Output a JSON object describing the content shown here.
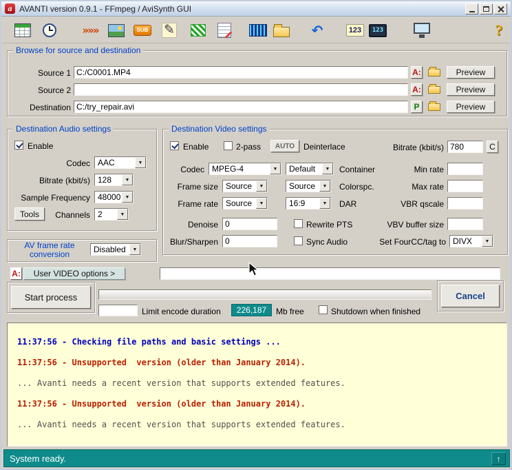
{
  "colors": {
    "group_title_blue": "#0040c8",
    "teal": "#0f8b8b",
    "log_bg": "#ffffd8",
    "log_blue": "#0000bb",
    "log_red": "#bb2000",
    "log_gray": "#505050",
    "badge_red": "#c11111",
    "badge_green": "#0a7a0a"
  },
  "ui": {
    "arrow": "▼"
  },
  "window": {
    "icon_letter": "a",
    "title": "AVANTI version 0.9.1 - FFmpeg / AviSynth GUI"
  },
  "toolbar": {
    "icons": [
      {
        "name": "job-control-icon",
        "glyph": ""
      },
      {
        "name": "timer-icon",
        "glyph": ""
      },
      {
        "name": "transitions-icon",
        "glyph": "»»»"
      },
      {
        "name": "image-editor-icon",
        "glyph": ""
      },
      {
        "name": "subtitles-icon",
        "glyph": "SUB"
      },
      {
        "name": "script-editor-icon",
        "glyph": "✎"
      },
      {
        "name": "priority-icon",
        "glyph": ""
      },
      {
        "name": "notes-icon",
        "glyph": ""
      },
      {
        "name": "waveform-icon",
        "glyph": ""
      },
      {
        "name": "folder-icon",
        "glyph": ""
      },
      {
        "name": "undo-icon",
        "glyph": "↶"
      },
      {
        "name": "numbers-icon",
        "glyph": "123"
      },
      {
        "name": "video-numbers-icon",
        "glyph": "123"
      },
      {
        "name": "monitor-icon",
        "glyph": ""
      },
      {
        "name": "help-icon",
        "glyph": "?"
      }
    ]
  },
  "browse": {
    "title": "Browse for source and destination",
    "preview_label": "Preview",
    "rows": [
      {
        "label": "Source 1",
        "value": "C:/C0001.MP4",
        "badge": "A:"
      },
      {
        "label": "Source 2",
        "value": "",
        "badge": "A:"
      },
      {
        "label": "Destination",
        "value": "C:/try_repair.avi",
        "badge": "P"
      }
    ]
  },
  "audio": {
    "title": "Destination Audio settings",
    "enable_label": "Enable",
    "codec_label": "Codec",
    "codec_value": "AAC",
    "bitrate_label": "Bitrate (kbit/s)",
    "bitrate_value": "128",
    "sample_label": "Sample Frequency",
    "sample_value": "48000",
    "tools_label": "Tools",
    "channels_label": "Channels",
    "channels_value": "2"
  },
  "video": {
    "title": "Destination Video settings",
    "enable_label": "Enable",
    "two_pass_label": "2-pass",
    "auto_label": "AUTO",
    "deinterlace_label": "Deinterlace",
    "bitrate_label": "Bitrate (kbit/s)",
    "bitrate_value": "780",
    "c_button_label": "C",
    "codec_label": "Codec",
    "codec_value": "MPEG-4",
    "profile_value": "Default",
    "container_label": "Container",
    "min_rate_label": "Min rate",
    "min_rate_value": "",
    "frame_size_label": "Frame size",
    "frame_size_value": "Source",
    "colorspace_value": "Source",
    "colorspace_label": "Colorspc.",
    "max_rate_label": "Max rate",
    "max_rate_value": "",
    "frame_rate_label": "Frame rate",
    "frame_rate_value": "Source",
    "dar_value": "16:9",
    "dar_label": "DAR",
    "vbr_qscale_label": "VBR qscale",
    "vbr_qscale_value": "",
    "denoise_label": "Denoise",
    "denoise_value": "0",
    "rewrite_pts_label": "Rewrite PTS",
    "vbv_label": "VBV buffer size",
    "vbv_value": "",
    "blur_label": "Blur/Sharpen",
    "blur_value": "0",
    "sync_audio_label": "Sync Audio",
    "fourcc_label": "Set FourCC/tag to",
    "fourcc_value": "DIVX"
  },
  "av_conversion": {
    "label_line1": "AV frame rate",
    "label_line2": "conversion",
    "value": "Disabled"
  },
  "user_options": {
    "badge": "A:",
    "button_label": "User VIDEO options >",
    "value": ""
  },
  "process": {
    "start_label": "Start process",
    "cancel_label": "Cancel",
    "limit_value": "",
    "limit_label": "Limit encode duration",
    "free_space_value": "226,187",
    "free_space_label": "Mb free",
    "shutdown_label": "Shutdown when finished"
  },
  "log": {
    "lines": [
      {
        "text": "11:37:56 - Checking file paths and basic settings ...",
        "color": "blue"
      },
      {
        "text": "11:37:56 - Unsupported  version (older than January 2014).",
        "color": "red"
      },
      {
        "text": "... Avanti needs a recent version that supports extended features.",
        "color": "gray"
      },
      {
        "text": "11:37:56 - Unsupported  version (older than January 2014).",
        "color": "red"
      },
      {
        "text": "... Avanti needs a recent version that supports extended features.",
        "color": "gray"
      }
    ]
  },
  "status": {
    "text": "System ready.",
    "scroll_glyph": "↑"
  }
}
